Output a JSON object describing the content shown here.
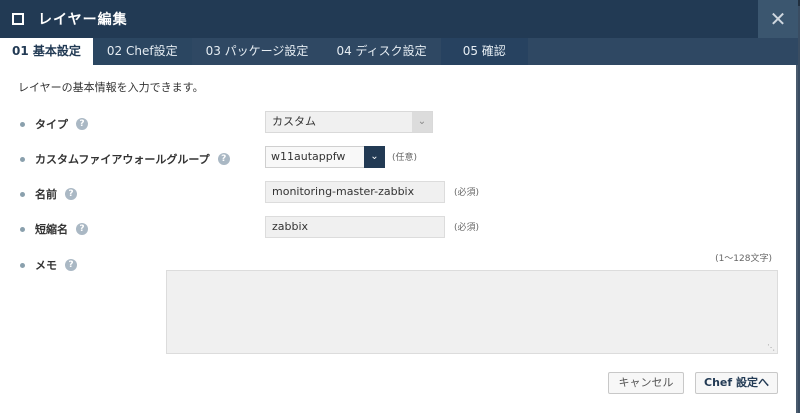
{
  "dialog": {
    "title": "レイヤー編集",
    "close_glyph": "✕"
  },
  "tabs": [
    {
      "label": "01 基本設定"
    },
    {
      "label": "02 Chef設定"
    },
    {
      "label": "03 パッケージ設定"
    },
    {
      "label": "04 ディスク設定"
    },
    {
      "label": "05 確認"
    }
  ],
  "form": {
    "intro": "レイヤーの基本情報を入力できます。",
    "type": {
      "label": "タイプ",
      "value": "カスタム"
    },
    "firewall": {
      "label": "カスタムファイアウォールグループ",
      "value": "w11autappfw",
      "note": "(任意)"
    },
    "name": {
      "label": "名前",
      "value": "monitoring-master-zabbix",
      "note": "(必須)"
    },
    "shortname": {
      "label": "短縮名",
      "value": "zabbix",
      "note": "(必須)"
    },
    "memo": {
      "label": "メモ",
      "note": "(1～128文字)",
      "value": ""
    }
  },
  "buttons": {
    "cancel": "キャンセル",
    "next": "Chef 設定へ"
  },
  "help_glyph": "?",
  "colors": {
    "titlebar": "#223a54",
    "tabbar": "#2f4863",
    "accent": "#223a54"
  }
}
